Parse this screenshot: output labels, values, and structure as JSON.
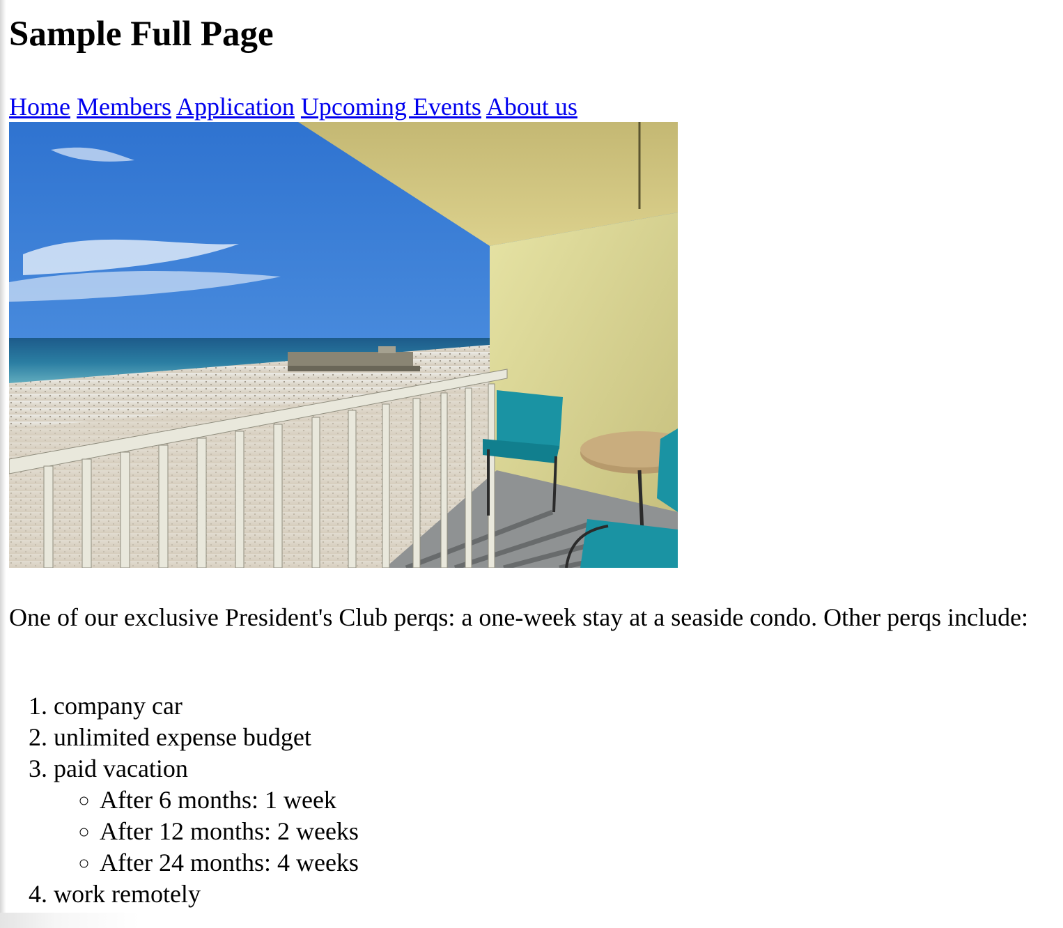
{
  "page": {
    "title": "Sample Full Page"
  },
  "nav": {
    "links": [
      "Home",
      "Members",
      "Application",
      "Upcoming Events",
      "About us"
    ]
  },
  "hero": {
    "alt": "Seaside condo balcony overlooking the beach"
  },
  "intro": "One of our exclusive President's Club perqs: a one-week stay at a seaside condo. Other perqs include:",
  "perqs": {
    "items": [
      "company car",
      "unlimited expense budget",
      "paid vacation",
      "work remotely"
    ],
    "vacation": [
      "After 6 months: 1 week",
      "After 12 months: 2 weeks",
      "After 24 months: 4 weeks"
    ]
  },
  "colors": {
    "link": "#0000ee",
    "text": "#000000"
  }
}
